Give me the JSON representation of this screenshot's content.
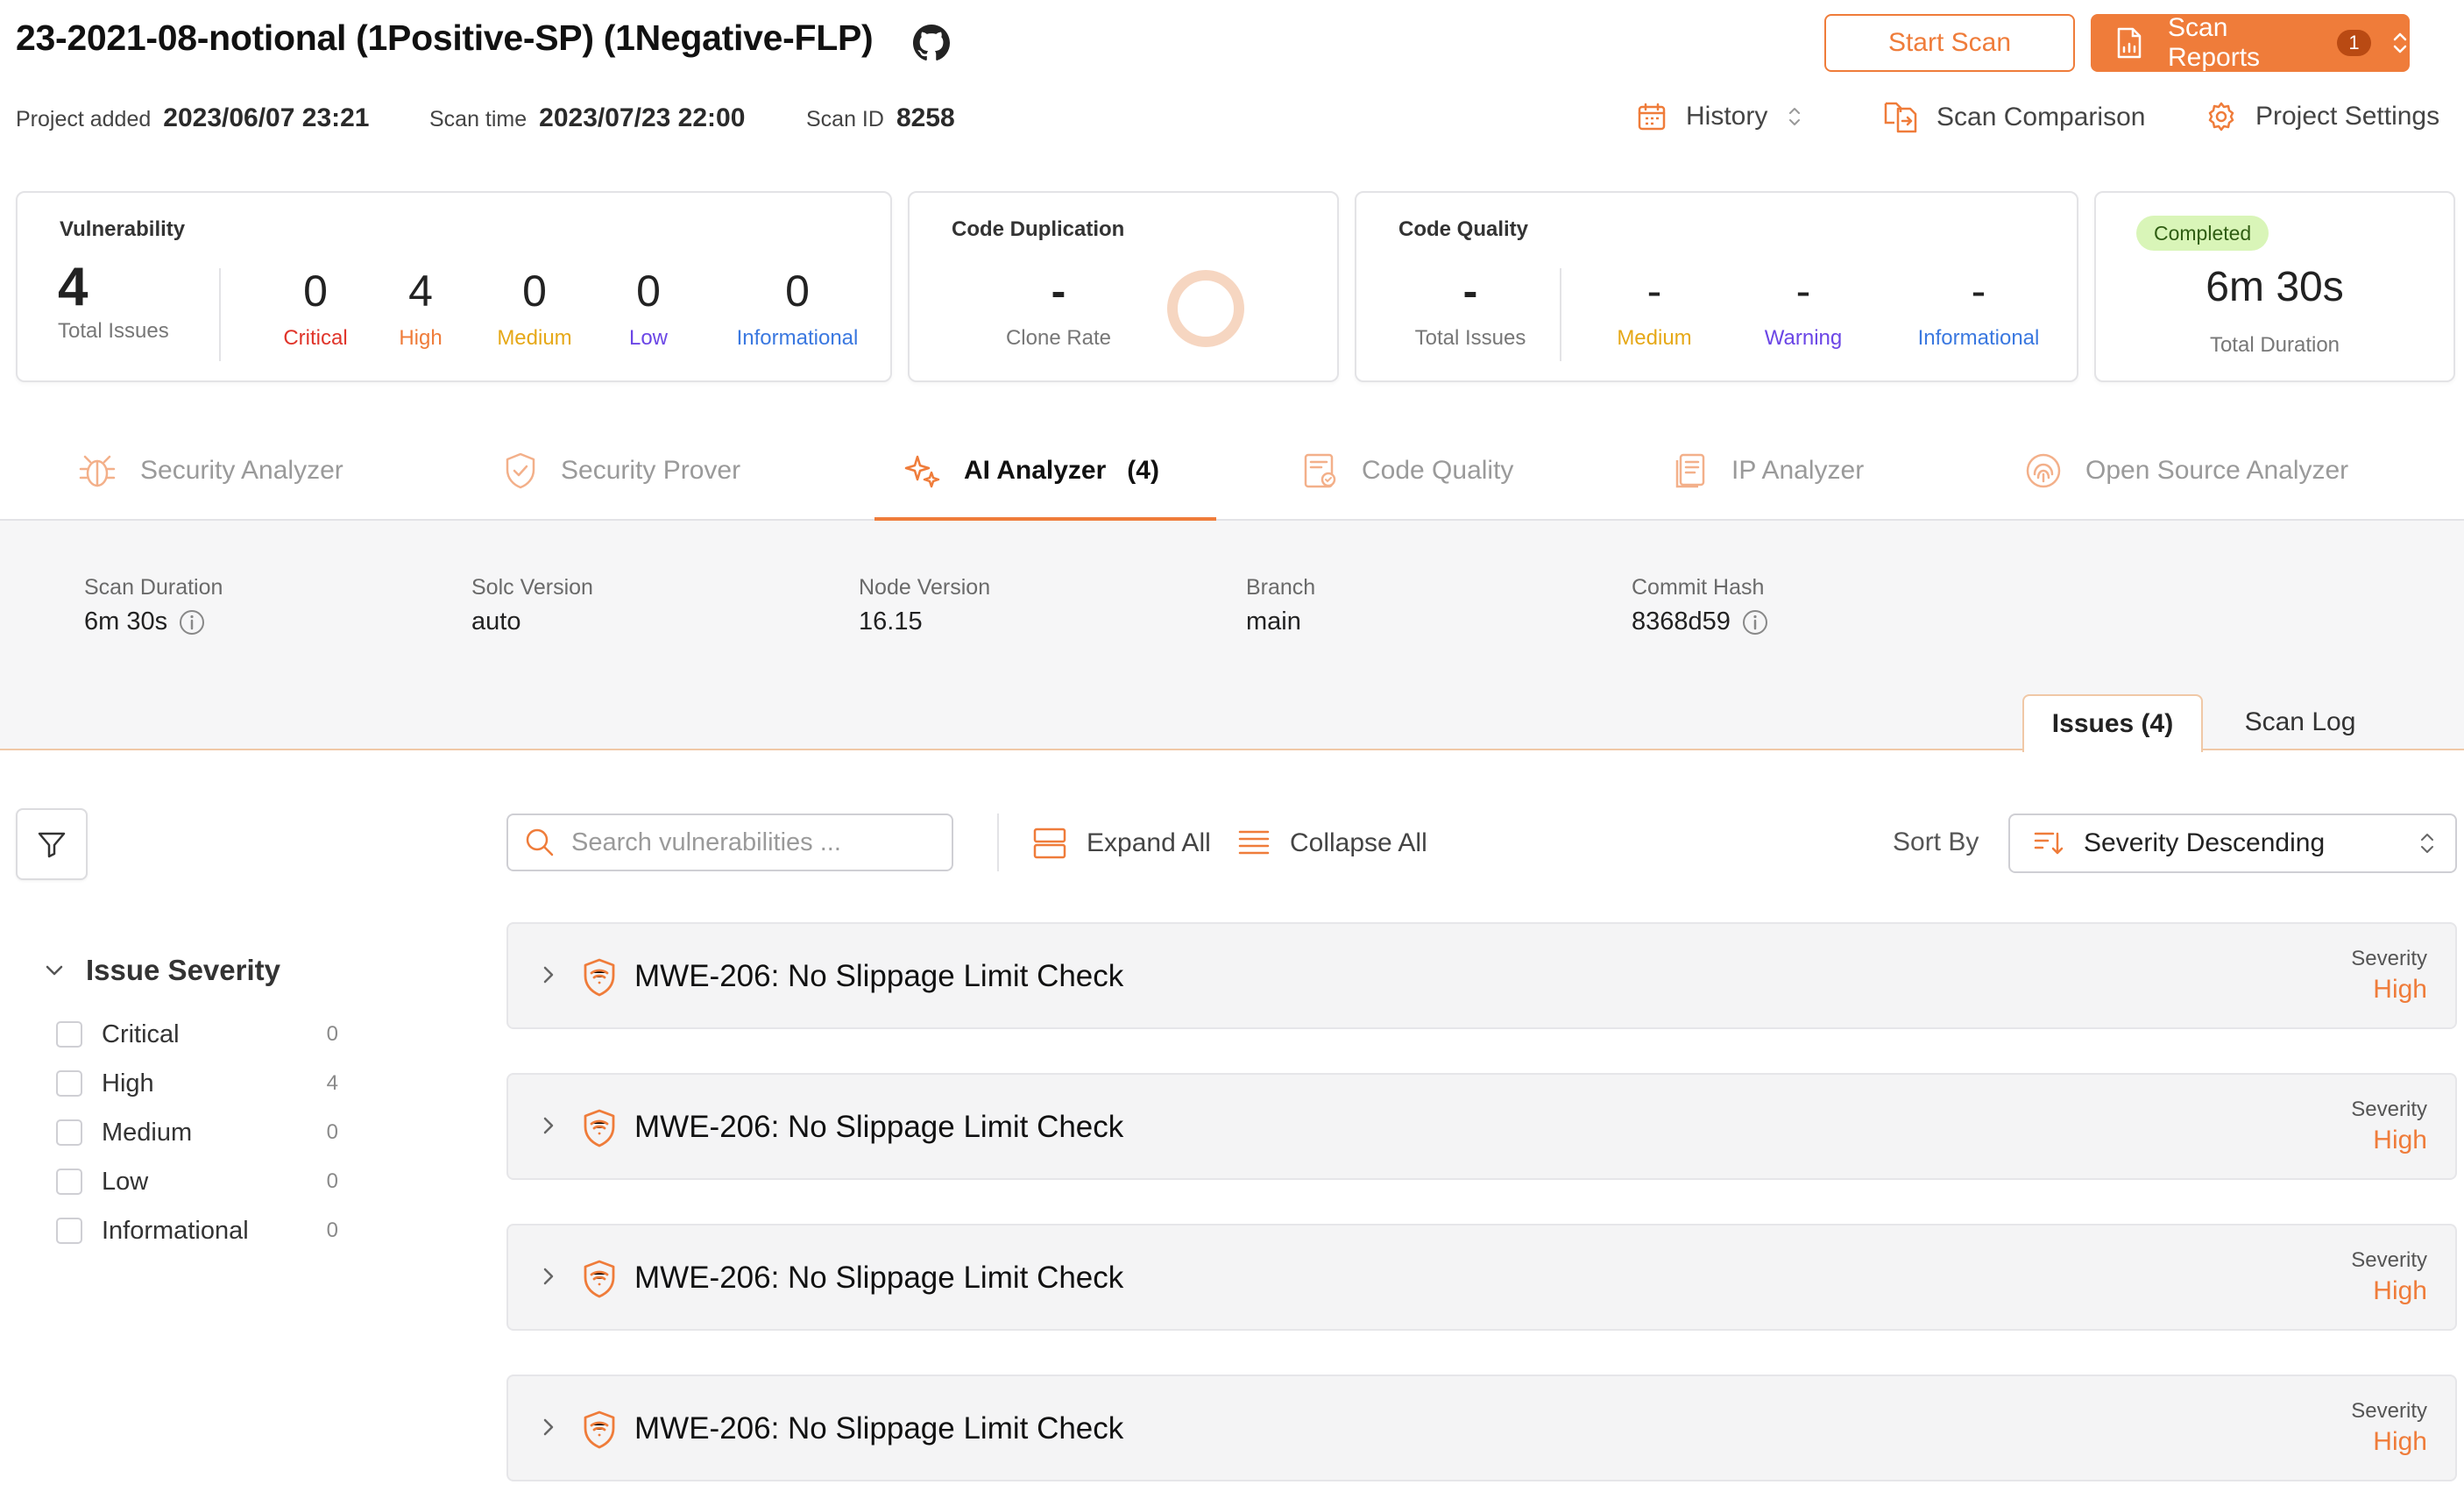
{
  "header": {
    "title": "23-2021-08-notional (1Positive-SP) (1Negative-FLP)",
    "start_scan_label": "Start Scan",
    "scan_reports_label": "Scan Reports",
    "scan_reports_count": "1",
    "project_added_label": "Project added",
    "project_added_value": "2023/06/07 23:21",
    "scan_time_label": "Scan time",
    "scan_time_value": "2023/07/23 22:00",
    "scan_id_label": "Scan ID",
    "scan_id_value": "8258",
    "history_label": "History",
    "scan_comparison_label": "Scan Comparison",
    "project_settings_label": "Project Settings"
  },
  "cards": {
    "vulnerability": {
      "title": "Vulnerability",
      "total": "4",
      "total_label": "Total Issues",
      "critical": "0",
      "critical_label": "Critical",
      "high": "4",
      "high_label": "High",
      "medium": "0",
      "medium_label": "Medium",
      "low": "0",
      "low_label": "Low",
      "informational": "0",
      "informational_label": "Informational"
    },
    "code_duplication": {
      "title": "Code Duplication",
      "clone_rate": "-",
      "clone_rate_label": "Clone Rate"
    },
    "code_quality": {
      "title": "Code Quality",
      "total": "-",
      "total_label": "Total Issues",
      "medium": "-",
      "medium_label": "Medium",
      "warning": "-",
      "warning_label": "Warning",
      "informational": "-",
      "informational_label": "Informational"
    },
    "duration": {
      "status": "Completed",
      "value": "6m 30s",
      "label": "Total Duration"
    }
  },
  "tabs": [
    {
      "label": "Security Analyzer",
      "icon": "bug-icon"
    },
    {
      "label": "Security Prover",
      "icon": "shield-check-icon"
    },
    {
      "label": "AI Analyzer",
      "count": "(4)",
      "icon": "sparkle-icon"
    },
    {
      "label": "Code Quality",
      "icon": "code-quality-icon"
    },
    {
      "label": "IP Analyzer",
      "icon": "document-icon"
    },
    {
      "label": "Open Source Analyzer",
      "icon": "fingerprint-icon"
    }
  ],
  "info": {
    "scan_duration_label": "Scan Duration",
    "scan_duration_value": "6m 30s",
    "solc_version_label": "Solc Version",
    "solc_version_value": "auto",
    "node_version_label": "Node Version",
    "node_version_value": "16.15",
    "branch_label": "Branch",
    "branch_value": "main",
    "commit_hash_label": "Commit Hash",
    "commit_hash_value": "8368d59"
  },
  "inner_tabs": {
    "issues_label": "Issues (4)",
    "scan_log_label": "Scan Log"
  },
  "toolbar": {
    "search_placeholder": "Search vulnerabilities ...",
    "expand_all_label": "Expand All",
    "collapse_all_label": "Collapse All",
    "sort_by_label": "Sort By",
    "sort_value": "Severity Descending"
  },
  "filters": {
    "heading": "Issue Severity",
    "items": [
      {
        "label": "Critical",
        "count": "0"
      },
      {
        "label": "High",
        "count": "4"
      },
      {
        "label": "Medium",
        "count": "0"
      },
      {
        "label": "Low",
        "count": "0"
      },
      {
        "label": "Informational",
        "count": "0"
      }
    ]
  },
  "issues": [
    {
      "title": "MWE-206: No Slippage Limit Check",
      "severity_label": "Severity",
      "severity": "High"
    },
    {
      "title": "MWE-206: No Slippage Limit Check",
      "severity_label": "Severity",
      "severity": "High"
    },
    {
      "title": "MWE-206: No Slippage Limit Check",
      "severity_label": "Severity",
      "severity": "High"
    },
    {
      "title": "MWE-206: No Slippage Limit Check",
      "severity_label": "Severity",
      "severity": "High"
    }
  ],
  "colors": {
    "accent": "#ef7c3a",
    "critical": "#e0352b",
    "high": "#ef7c3a",
    "medium": "#e6a817",
    "low": "#6b46e6",
    "informational": "#3a78e0",
    "completed_bg": "#d9f5b8"
  }
}
